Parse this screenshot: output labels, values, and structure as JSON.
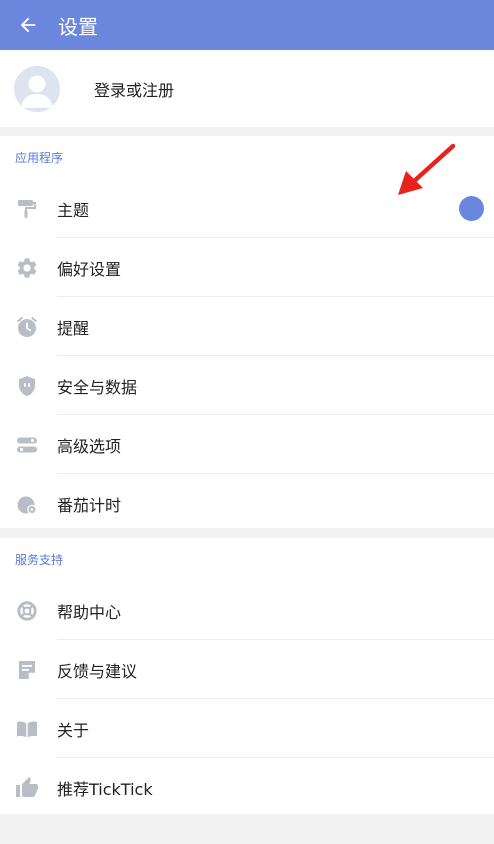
{
  "header": {
    "title": "设置",
    "back_icon": "arrow-left-icon",
    "bg_color": "#6b86dd"
  },
  "account": {
    "label": "登录或注册",
    "avatar_icon": "default-avatar-icon"
  },
  "application": {
    "title": "应用程序",
    "items": [
      {
        "label": "主题",
        "icon": "paint-roller-icon"
      },
      {
        "label": "偏好设置",
        "icon": "gear-icon"
      },
      {
        "label": "提醒",
        "icon": "alarm-clock-icon"
      },
      {
        "label": "安全与数据",
        "icon": "shield-icon"
      },
      {
        "label": "高级选项",
        "icon": "toggles-icon"
      },
      {
        "label": "番茄计时",
        "icon": "tomato-timer-icon"
      }
    ],
    "theme_color": "#6b86dd"
  },
  "support": {
    "title": "服务支持",
    "items": [
      {
        "label": "帮助中心",
        "icon": "lifebuoy-icon"
      },
      {
        "label": "反馈与建议",
        "icon": "feedback-note-icon"
      },
      {
        "label": "关于",
        "icon": "book-icon"
      },
      {
        "label": "推荐TickTick",
        "icon": "thumbs-up-icon"
      }
    ]
  },
  "annotation": {
    "arrow_color": "#e8211b"
  }
}
